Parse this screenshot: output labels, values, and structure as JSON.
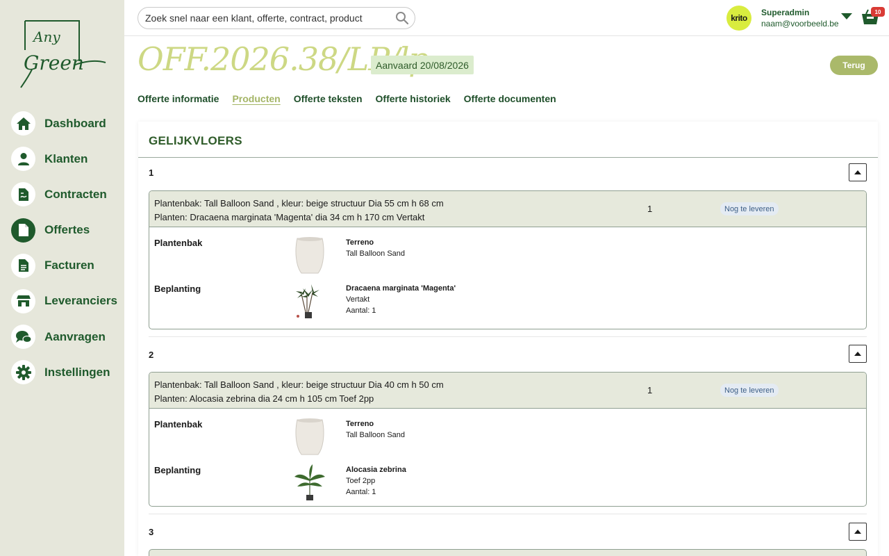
{
  "search": {
    "placeholder": "Zoek snel naar een klant, offerte, contract, product"
  },
  "user": {
    "avatar_text": "krito",
    "name": "Superadmin",
    "email": "naam@voorbeeld.be",
    "cart_count": "10"
  },
  "sidebar": {
    "logo_alt": "Any Green",
    "items": [
      {
        "label": "Dashboard",
        "icon": "home-icon"
      },
      {
        "label": "Klanten",
        "icon": "user-icon"
      },
      {
        "label": "Contracten",
        "icon": "contract-icon"
      },
      {
        "label": "Offertes",
        "icon": "document-icon",
        "active": true
      },
      {
        "label": "Facturen",
        "icon": "invoice-icon"
      },
      {
        "label": "Leveranciers",
        "icon": "store-icon"
      },
      {
        "label": "Aanvragen",
        "icon": "chat-icon"
      },
      {
        "label": "Instellingen",
        "icon": "gear-icon"
      }
    ]
  },
  "header": {
    "title": "OFF.2026.38/LP/lp",
    "status": "Aanvaard 20/08/2026",
    "back_label": "Terug"
  },
  "tabs": [
    {
      "label": "Offerte informatie"
    },
    {
      "label": "Producten",
      "active": true
    },
    {
      "label": "Offerte teksten"
    },
    {
      "label": "Offerte historiek"
    },
    {
      "label": "Offerte documenten"
    }
  ],
  "section": {
    "title": "GELIJKVLOERS",
    "items": [
      {
        "number": "1",
        "line1": "Plantenbak: Tall Balloon Sand , kleur: beige structuur Dia 55 cm h 68 cm",
        "line2": "Planten: Dracaena marginata 'Magenta' dia 34 cm h 170 cm Vertakt",
        "qty": "1",
        "status": "Nog te leveren",
        "planter": {
          "label": "Plantenbak",
          "brand": "Terreno",
          "name": "Tall Balloon Sand"
        },
        "plant": {
          "label": "Beplanting",
          "name": "Dracaena marginata 'Magenta'",
          "variant": "Vertakt",
          "amount": "Aantal: 1"
        }
      },
      {
        "number": "2",
        "line1": "Plantenbak: Tall Balloon Sand , kleur: beige structuur Dia 40 cm h 50 cm",
        "line2": "Planten: Alocasia zebrina dia 24 cm h 105 cm Toef 2pp",
        "qty": "1",
        "status": "Nog te leveren",
        "planter": {
          "label": "Plantenbak",
          "brand": "Terreno",
          "name": "Tall Balloon Sand"
        },
        "plant": {
          "label": "Beplanting",
          "name": "Alocasia zebrina",
          "variant": "Toef 2pp",
          "amount": "Aantal: 1"
        }
      },
      {
        "number": "3"
      }
    ]
  },
  "colors": {
    "brand_green": "#1f5a2c",
    "accent_olive": "#aab96a",
    "title_lime": "#cdd884",
    "sidebar_bg": "#e6e7db"
  }
}
